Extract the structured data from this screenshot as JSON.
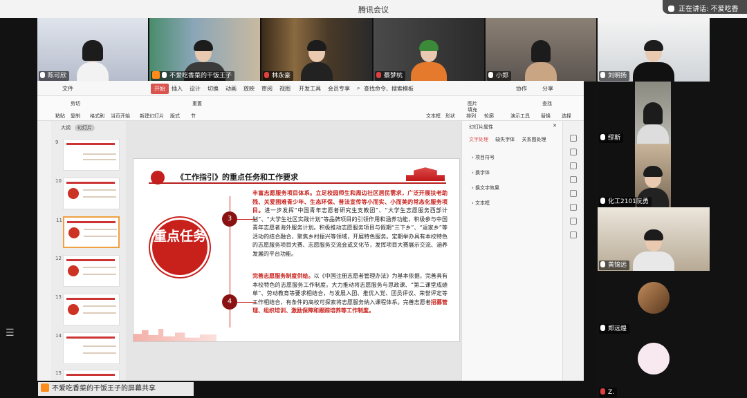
{
  "window": {
    "title": "腾讯会议",
    "speaking_label": "正在讲话: 不爱吃香"
  },
  "participants_top": [
    {
      "name": "陈可欣",
      "mic": "on"
    },
    {
      "name": "不爱吃香菜的干饭王子",
      "mic": "on",
      "host_icon": true
    },
    {
      "name": "林永豪",
      "mic": "muted"
    },
    {
      "name": "蔡梦杭",
      "mic": "muted"
    },
    {
      "name": "小郑",
      "mic": "on"
    }
  ],
  "participants_right": [
    {
      "name": "刘明扬",
      "mic": "on"
    },
    {
      "name": "缪斯",
      "mic": "on"
    },
    {
      "name": "化工2101阮勇",
      "mic": "on"
    },
    {
      "name": "黄锦远",
      "mic": "on"
    },
    {
      "name": "郑远煌",
      "mic": "on"
    },
    {
      "name": "Z.",
      "mic": "muted"
    }
  ],
  "ppt": {
    "menu": [
      "文件",
      "开始",
      "插入",
      "设计",
      "切换",
      "动画",
      "放映",
      "审阅",
      "视图",
      "开发工具",
      "会员专享"
    ],
    "active_menu": "开始",
    "search_placeholder": "查找命令、搜索模板",
    "menu_right": [
      "协作",
      "分享"
    ],
    "ribbon_labels": [
      "粘贴",
      "剪切",
      "复制",
      "格式刷",
      "当页开始",
      "新建幻灯片",
      "版式",
      "节",
      "重置",
      "文本框",
      "形状",
      "排列",
      "轮廓",
      "演示工具",
      "替换",
      "选择",
      "查找",
      "图片",
      "填充"
    ],
    "thumb_tabs": [
      "大纲",
      "幻灯片"
    ],
    "thumb_numbers": [
      "9",
      "10",
      "11",
      "12",
      "13",
      "14",
      "15"
    ],
    "selected_thumb": "11",
    "right_panel": {
      "title": "幻灯片属性",
      "tabs": [
        "文字处理",
        "缺失字体",
        "关系图处理"
      ],
      "items": [
        "项目符号",
        "换字体",
        "换文字效果",
        "文本框"
      ]
    }
  },
  "slide": {
    "title": "《工作指引》的重点任务和工作要求",
    "badge": "重点任务",
    "num1": "3",
    "num2": "4",
    "p1_bold": "丰富志愿服务项目体系。立足校园师生和周边社区居民需求，广泛开展扶老助残、关爱困难青少年、生态环保、普法宣传等小而实、小而美的常态化服务项目。",
    "p1_text": "进一步发挥“中国青年志愿者研究生支教团”、“大学生志愿服务西部计划”、“大学生社区实践计划”等品牌项目的引领作用和涵养功能，积极参与中国青年志愿者海外服务计划。积极推动志愿服务项目与假期“三下乡”、“返家乡”等活动的结合融合，聚焦乡村振兴等领域，开展特色服务。定期举办具有本校特色的志愿服务项目大赛、志愿服务交流会或文化节，发挥项目大赛展示交流、涵养发展的平台功能。",
    "p2_bold": "完善志愿服务制度供给。",
    "p2_text": "以《中国注册志愿者管理办法》为基本依据，完善具有本校特色的志愿服务工作制度。大力推动将志愿服务与思政课、“第二课堂成绩单”、劳动教育等要求相结合，与发展入团、推优入党、团员评议、荣誉评定等工作相结合，有条件的高校可探索将志愿服务纳入课程体系。完善志愿者",
    "p2_tail": "招募管理、组织培训、激励保障和跟踪培养等工作制度。"
  },
  "share_bar": {
    "label": "不爱吃香菜的干饭王子的屏幕共享"
  },
  "colors": {
    "accent_red": "#c8211c",
    "tencent_orange": "#ff8c1a"
  }
}
